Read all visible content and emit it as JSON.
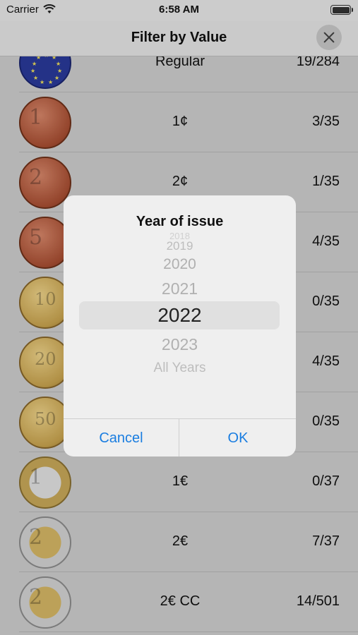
{
  "status": {
    "carrier": "Carrier",
    "time": "6:58 AM"
  },
  "nav": {
    "title": "Filter by Value"
  },
  "rows": [
    {
      "name": "Regular",
      "count": "19/284"
    },
    {
      "name": "1¢",
      "count": "3/35"
    },
    {
      "name": "2¢",
      "count": "1/35"
    },
    {
      "name": "",
      "count": "4/35"
    },
    {
      "name": "",
      "count": "0/35"
    },
    {
      "name": "",
      "count": "4/35"
    },
    {
      "name": "",
      "count": "0/35"
    },
    {
      "name": "1€",
      "count": "0/37"
    },
    {
      "name": "2€",
      "count": "7/37"
    },
    {
      "name": "2€ CC",
      "count": "14/501"
    }
  ],
  "coins": [
    "",
    "1",
    "2",
    "5",
    "10",
    "20",
    "50",
    "1",
    "2",
    "2"
  ],
  "dialog": {
    "title": "Year of issue",
    "options": [
      "2018",
      "2019",
      "2020",
      "2021",
      "2022",
      "2023",
      "All Years"
    ],
    "selected": "2022",
    "cancel": "Cancel",
    "ok": "OK"
  },
  "colors": {
    "accent": "#1a7de0"
  }
}
